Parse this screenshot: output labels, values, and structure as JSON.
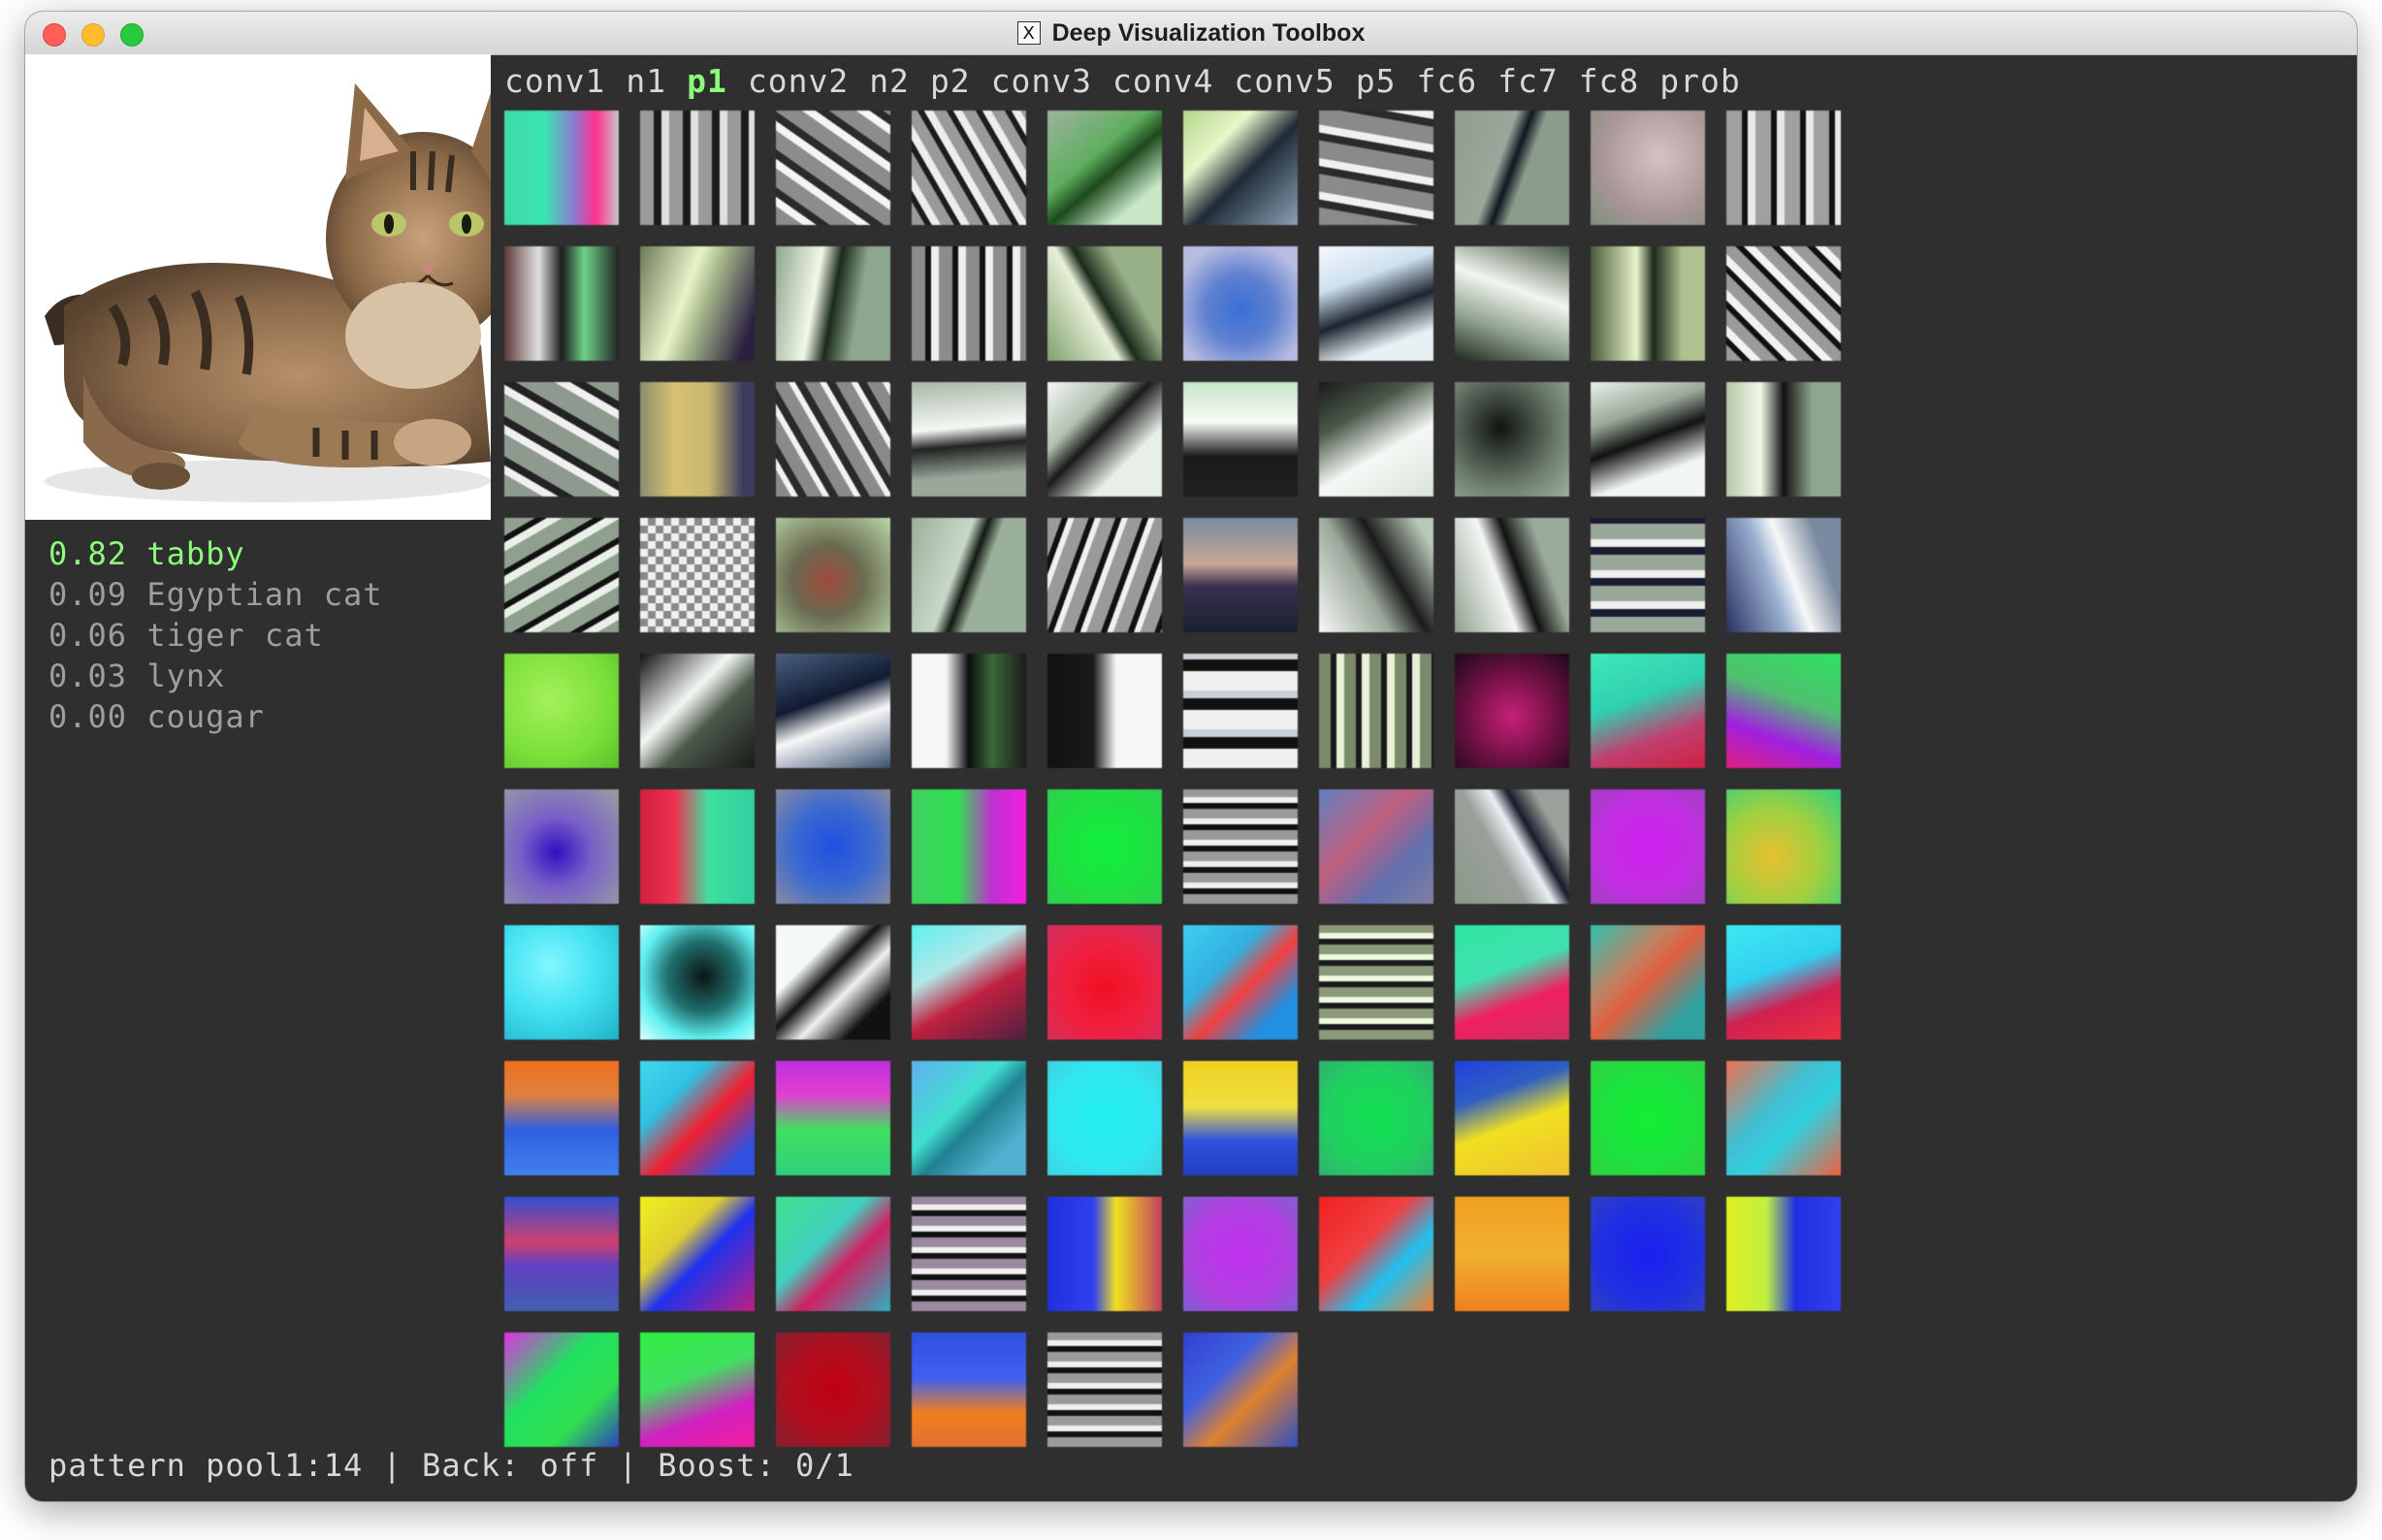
{
  "window": {
    "title": "Deep Visualization Toolbox",
    "app_icon": "x11-icon",
    "app_icon_glyph": "X"
  },
  "predictions": [
    {
      "text": "0.82 tabby"
    },
    {
      "text": "0.09 Egyptian cat"
    },
    {
      "text": "0.06 tiger cat"
    },
    {
      "text": "0.03 lynx"
    },
    {
      "text": "0.00 cougar"
    }
  ],
  "layers": [
    {
      "label": "conv1"
    },
    {
      "label": "n1"
    },
    {
      "label": "p1"
    },
    {
      "label": "conv2"
    },
    {
      "label": "n2"
    },
    {
      "label": "p2"
    },
    {
      "label": "conv3"
    },
    {
      "label": "conv4"
    },
    {
      "label": "conv5"
    },
    {
      "label": "p5"
    },
    {
      "label": "fc6"
    },
    {
      "label": "fc7"
    },
    {
      "label": "fc8"
    },
    {
      "label": "prob"
    }
  ],
  "active_layer": "p1",
  "status_bar": {
    "mode": "pattern pool1:14",
    "back": "Back: off",
    "boost": "Boost: 0/1"
  },
  "colors": {
    "background": "#2f2f2f",
    "active_green": "#8dfd7c",
    "text_gray": "#9e9e9e",
    "text_light": "#d8d8d8"
  },
  "filters": [
    "linear-gradient(90deg,#3fd9a8 0%,#39e6b0 35%,#8a7fd0 60%,#ff2f8f 80%,#c7c7c7 100%)",
    "repeating-linear-gradient(90deg,#9a9a9a 0 14px,#1b1b1b 14px 22px,#e0e0e0 22px 30px)",
    "repeating-linear-gradient(35deg,#8c8c8c 0 16px,#f4f4f4 16px 24px,#2a2a2a 24px 32px)",
    "repeating-linear-gradient(60deg,#9a9a9a 0 12px,#1c1c1c 12px 18px,#ededed 18px 26px)",
    "linear-gradient(140deg,#9fb39f 0%,#5fae5f 40%,#1c4a1c 55%,#c9e8c9 80%)",
    "linear-gradient(135deg,#b0d88a 0%,#e8f6c9 30%,#1e2a36 55%,#8aa0b6 100%)",
    "repeating-linear-gradient(10deg,#8a8a8a 0 18px,#2b2b2b 18px 26px,#f0f0f0 26px 34px)",
    "linear-gradient(110deg,#8f9e8f 0%,#9aa79a 40%,#0f1720 50%,#8c9c8c 60%)",
    "radial-gradient(circle at 60% 40%,#d7c2c2 0%,#a89696 60%,#7f8f7f 100%)",
    "repeating-linear-gradient(90deg,#a0a0a0 0 16px,#111 16px 22px,#e8e8e8 22px 30px)",
    "linear-gradient(90deg,#5e3a3a 0%,#e0e0e0 30%,#1c1c1c 50%,#6fd18a 70%,#222 100%)",
    "linear-gradient(110deg,#6c7a5a 0%,#e8f4c8 40%,#a5b78a 55%,#2b2040 90%)",
    "linear-gradient(100deg,#8ea68e 0%,#f2f8e8 35%,#1a2a1a 50%,#8ea68e 70%)",
    "repeating-linear-gradient(90deg,#8c8c8c 0 14px,#111 14px 20px,#efefef 20px 28px)",
    "linear-gradient(60deg,#7fa06f 0%,#e8f0d8 40%,#1a2a1a 50%,#98b088 70%)",
    "radial-gradient(circle at 50% 55%,#3a70d6 0%,#5e80d0 40%,#b8bce0 80%)",
    "linear-gradient(160deg,#f4f8ff 0%,#cfe0ee 30%,#1c2430 55%,#e8f0f4 80%)",
    "linear-gradient(200deg,#4a5a4a 0%,#f2f6ee 40%,#8ea08e 70%,#202820 100%)",
    "linear-gradient(90deg,#4a5a3a 0%,#e8f4c8 40%,#1a2a1a 55%,#b0c090 80%)",
    "repeating-linear-gradient(45deg,#9a9a9a 0 12px,#111 12px 18px,#f2f2f2 18px 26px)",
    "repeating-linear-gradient(30deg,#8f9a8f 0 20px,#f0f0f0 20px 28px,#222 28px 36px)",
    "linear-gradient(90deg,#8a8f70 0%,#d8c070 30%,#c8b870 60%,#3c3c60 90%)",
    "repeating-linear-gradient(60deg,#8a8a8a 0 14px,#f2f2f2 14px 20px,#2a2a2a 20px 28px)",
    "linear-gradient(175deg,#a8b8a8 0%,#f4f8f4 40%,#222 55%,#9aa89a 80%)",
    "linear-gradient(135deg,#f6f8f4 0%,#b0c0b0 30%,#1a1a1a 45%,#e8efe8 70%)",
    "linear-gradient(180deg,#c8e6c8 0%,#f8fbf8 35%,#1a1a1a 65%,#202020 100%)",
    "linear-gradient(150deg,#1a1a1a 0%,#4a5a4a 30%,#f6f8f6 60%,#d8e4d8 100%)",
    "radial-gradient(circle at 40% 40%,#0e1410 0%,#6c7c6c 60%,#a0b0a0 100%)",
    "linear-gradient(160deg,#e8f0e8 0%,#98a898 30%,#111 50%,#f2f6f2 75%)",
    "linear-gradient(90deg,#b6c8a8 0%,#f0f8e8 30%,#111 50%,#8ea68e 75%)",
    "repeating-linear-gradient(150deg,#8fa08f 0 16px,#111 16px 22px,#e8f0e8 22px 30px)",
    "repeating-conic-gradient(#888 0 25%,#f0f0f0 0 50%) 0 0/16px 16px",
    "radial-gradient(circle at 45% 55%,#a04a3a 0%,#6a6a50 40%,#b8d8a8 100%)",
    "linear-gradient(110deg,#9ab09a 0%,#c8d8c8 40%,#121812 50%,#9ab09a 60%)",
    "repeating-linear-gradient(110deg,#9a9a9a 0 14px,#111 14px 20px,#f0f0f0 20px 26px)",
    "linear-gradient(180deg,#7a8aa0 0%,#c8a898 40%,#3a3050 60%,#1a2030 100%)",
    "linear-gradient(60deg,#f6f8f6 0%,#9aa89a 40%,#1a1a1a 60%,#b8c8b8 90%)",
    "linear-gradient(70deg,#8ea08e 0%,#f4f6f4 40%,#111 55%,#9aaa9a 75%)",
    "repeating-linear-gradient(0deg,#9aa89a 0 16px,#1a1a30 16px 24px,#f0f0f0 24px 32px)",
    "linear-gradient(70deg,#2a3060 0%,#9ab0d0 40%,#f8f8f8 55%,#7a8aa0 80%)",
    "radial-gradient(circle at 40% 40%,#a6f05a 0%,#7ae03a 60%,#5ac02a 100%)",
    "linear-gradient(135deg,#111 0%,#f4f8f4 40%,#4a5a4a 60%,#1a1a1a 100%)",
    "linear-gradient(160deg,#4a6080 0%,#101a30 40%,#f8f8f8 60%,#3a5070 100%)",
    "linear-gradient(90deg,#f6f6f6 0%,#f6f6f6 30%,#0c0c0c 50%,#3a6a3a 70%,#1a1a1a 100%)",
    "linear-gradient(90deg,#111 0%,#1a1a1a 40%,#f6f6f6 60%,#f6f6f6 100%)",
    "repeating-linear-gradient(0deg,#f0f0f0 0 20px,#111 20px 32px,#c8d0d8 32px 40px)",
    "repeating-linear-gradient(90deg,#7a8a6a 0 12px,#1a1a1a 12px 18px,#e8f0d8 18px 26px)",
    "radial-gradient(circle at 50% 55%,#c8207a 0%,#6a1040 55%,#1a0a1a 100%)",
    "linear-gradient(160deg,#40e8b8 0%,#30d0b0 40%,#c04070 70%,#d02040 100%)",
    "linear-gradient(200deg,#30e060 0%,#50c070 40%,#a020e0 70%,#e02080 100%)",
    "radial-gradient(ellipse at 45% 55%,#3010c0 0%,#7860c8 40%,#9aa0a0 100%)",
    "linear-gradient(90deg,#d02040 0%,#f03050 30%,#40e0a0 60%,#30d0a0 100%)",
    "radial-gradient(circle at 50% 50%,#2050e0 0%,#3a6ad0 50%,#8a8aa0 100%)",
    "linear-gradient(90deg,#40d060 0%,#30e050 40%,#c030d0 70%,#f020e0 100%)",
    "radial-gradient(circle at 50% 50%,#10f040 0%,#20e040 60%,#30d050 100%)",
    "repeating-linear-gradient(0deg,#9a9a9a 0 10px,#111 10px 16px,#f0f0f0 16px 22px)",
    "linear-gradient(135deg,#6080c0 0%,#c06080 40%,#6070b0 70%,#8080a0 100%)",
    "linear-gradient(60deg,#8a9a8a 0%,#9aa09a 40%,#e8f0f4 55%,#1a1a2a 65%,#9aa09a 80%)",
    "radial-gradient(circle at 50% 50%,#d020f0 0%,#c030e0 60%,#a040c0 100%)",
    "radial-gradient(circle at 40% 60%,#e8c030 0%,#a0d040 50%,#30d080 100%)",
    "radial-gradient(circle at 40% 35%,#80f8ff 0%,#40e0f0 50%,#20b0c8 100%)",
    "radial-gradient(circle at 55% 45%,#0c1414 0%,#207070 40%,#60f0f0 70%,#e0ffff 100%)",
    "linear-gradient(135deg,#f4f8f8 0%,#f4f8f8 30%,#111 45%,#f0f0f0 60%,#111 80%)",
    "linear-gradient(150deg,#60f0f0 0%,#b0e8e8 35%,#c02040 60%,#502040 100%)",
    "radial-gradient(circle at 50% 55%,#f01020 0%,#f02040 50%,#d03060 100%)",
    "linear-gradient(135deg,#40d0f0 0%,#30b0e0 35%,#f04040 55%,#2090e0 80%)",
    "repeating-linear-gradient(0deg,#8a9a7a 0 10px,#1a1a1a 10px 16px,#f0f8e0 16px 22px)",
    "linear-gradient(160deg,#30e8a0 0%,#40e0b0 40%,#f02060 65%,#d03060 100%)",
    "linear-gradient(135deg,#30c0b0 0%,#c08060 35%,#e06040 50%,#30a0a0 80%)",
    "linear-gradient(160deg,#40e8f0 0%,#30d0f0 40%,#d02050 65%,#f03040 100%)",
    "linear-gradient(180deg,#f07020 0%,#e08040 30%,#3060e0 60%,#4080f0 100%)",
    "linear-gradient(135deg,#40d8f0 0%,#30c0e0 30%,#f02030 55%,#3050e0 85%)",
    "linear-gradient(180deg,#c030e0 0%,#e040d0 30%,#40e060 60%,#30d080 100%)",
    "linear-gradient(135deg,#60b0f0 0%,#40e0d0 40%,#208090 55%,#50b0d0 80%)",
    "radial-gradient(circle at 50% 50%,#20f0f0 0%,#30e8f0 60%,#40d0e0 100%)",
    "linear-gradient(180deg,#f0d020 0%,#f0e040 40%,#3050e0 70%,#2040c0 100%)",
    "radial-gradient(circle at 50% 50%,#10e050 0%,#20d060 60%,#30b070 100%)",
    "linear-gradient(160deg,#2040e0 0%,#3060c0 30%,#f0e020 55%,#f0c030 100%)",
    "radial-gradient(circle at 50% 50%,#10f030 0%,#20e040 60%,#30d040 100%)",
    "linear-gradient(135deg,#f07050 0%,#40c0d0 40%,#30d0e0 60%,#f06040 100%)",
    "linear-gradient(180deg,#3050d0 0%,#d04070 40%,#6040c0 60%,#4060b0 100%)",
    "linear-gradient(135deg,#f0f020 0%,#e0d030 35%,#2030f0 55%,#c02080 100%)",
    "linear-gradient(135deg,#40e090 0%,#40d0c0 40%,#d02060 60%,#30b0c0 100%)",
    "repeating-linear-gradient(0deg,#9a8aa0 0 10px,#111 10px 16px,#f0f0f0 16px 22px)",
    "linear-gradient(90deg,#2030e0 0%,#3040f0 40%,#f0e020 60%,#c04060 100%)",
    "radial-gradient(circle at 50% 50%,#c030f0 0%,#b040e0 60%,#8060d0 100%)",
    "linear-gradient(135deg,#f02020 0%,#f04040 40%,#20c0f0 65%,#f08030 100%)",
    "linear-gradient(180deg,#f0a020 0%,#f0b030 50%,#f08020 100%)",
    "radial-gradient(circle at 50% 50%,#1a20f0 0%,#2030e0 60%,#3040c0 100%)",
    "linear-gradient(90deg,#e0f020 0%,#c0f040 35%,#2030e0 60%,#3040f0 100%)",
    "linear-gradient(135deg,#e030e0 0%,#20e060 40%,#30e050 70%,#3040c0 100%)",
    "linear-gradient(160deg,#30f040 0%,#40e060 40%,#d020c0 70%,#f020a0 100%)",
    "radial-gradient(circle at 50% 50%,#c00010 0%,#b01020 55%,#802030 100%)",
    "linear-gradient(180deg,#3050e0 0%,#4060f0 40%,#f08020 70%,#e07030 100%)",
    "repeating-linear-gradient(0deg,#9a9a9a 0 10px,#111 10px 16px,#f0f0f0 16px 22px)",
    "linear-gradient(135deg,#3040d0 0%,#4060e0 35%,#e08030 60%,#3050c0 100%)"
  ]
}
